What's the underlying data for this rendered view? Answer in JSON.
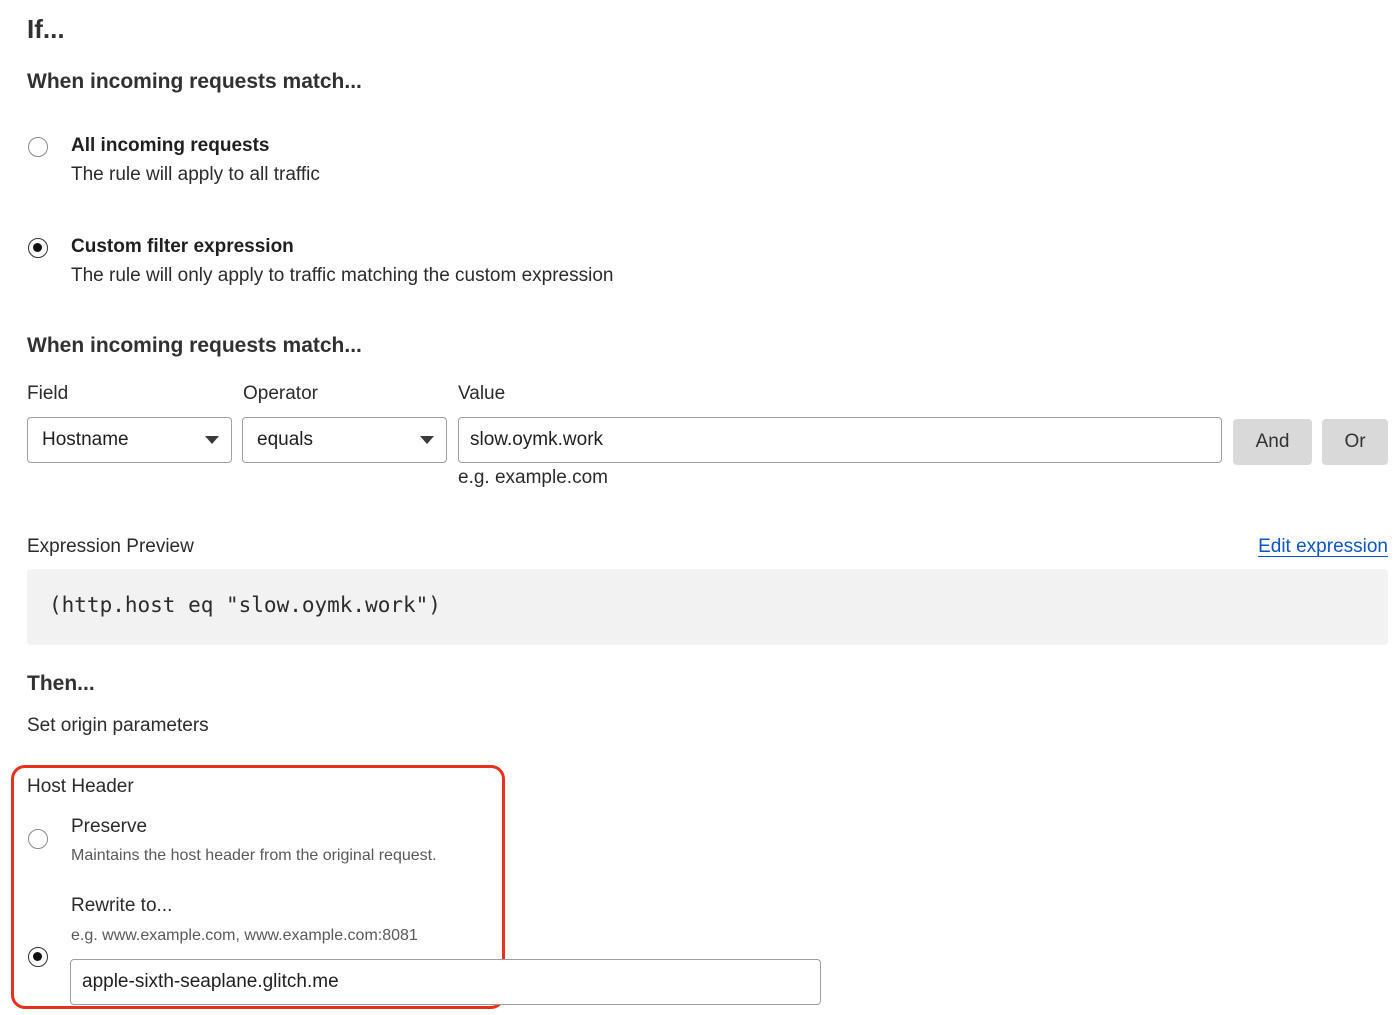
{
  "if_section": {
    "heading": "If...",
    "match_heading": "When incoming requests match...",
    "options": [
      {
        "title": "All incoming requests",
        "description": "The rule will apply to all traffic",
        "selected": false
      },
      {
        "title": "Custom filter expression",
        "description": "The rule will only apply to traffic matching the custom expression",
        "selected": true
      }
    ]
  },
  "expression_builder": {
    "heading": "When incoming requests match...",
    "field_label": "Field",
    "operator_label": "Operator",
    "value_label": "Value",
    "field_value": "Hostname",
    "operator_value": "equals",
    "value_value": "slow.oymk.work",
    "value_hint": "e.g. example.com",
    "and_label": "And",
    "or_label": "Or"
  },
  "preview": {
    "label": "Expression Preview",
    "edit_link": "Edit expression",
    "expression": "(http.host eq \"slow.oymk.work\")"
  },
  "then_section": {
    "heading": "Then...",
    "subheading": "Set origin parameters",
    "host_header_label": "Host Header",
    "preserve_title": "Preserve",
    "preserve_description": "Maintains the host header from the original request.",
    "rewrite_title": "Rewrite to...",
    "rewrite_hint": "e.g. www.example.com, www.example.com:8081",
    "rewrite_value": "apple-sixth-seaplane.glitch.me",
    "selected": "rewrite"
  },
  "colors": {
    "highlight": "#e8311b",
    "link": "#0b55c6",
    "button_bg": "#d9d9d9",
    "preview_bg": "#f2f2f2"
  }
}
